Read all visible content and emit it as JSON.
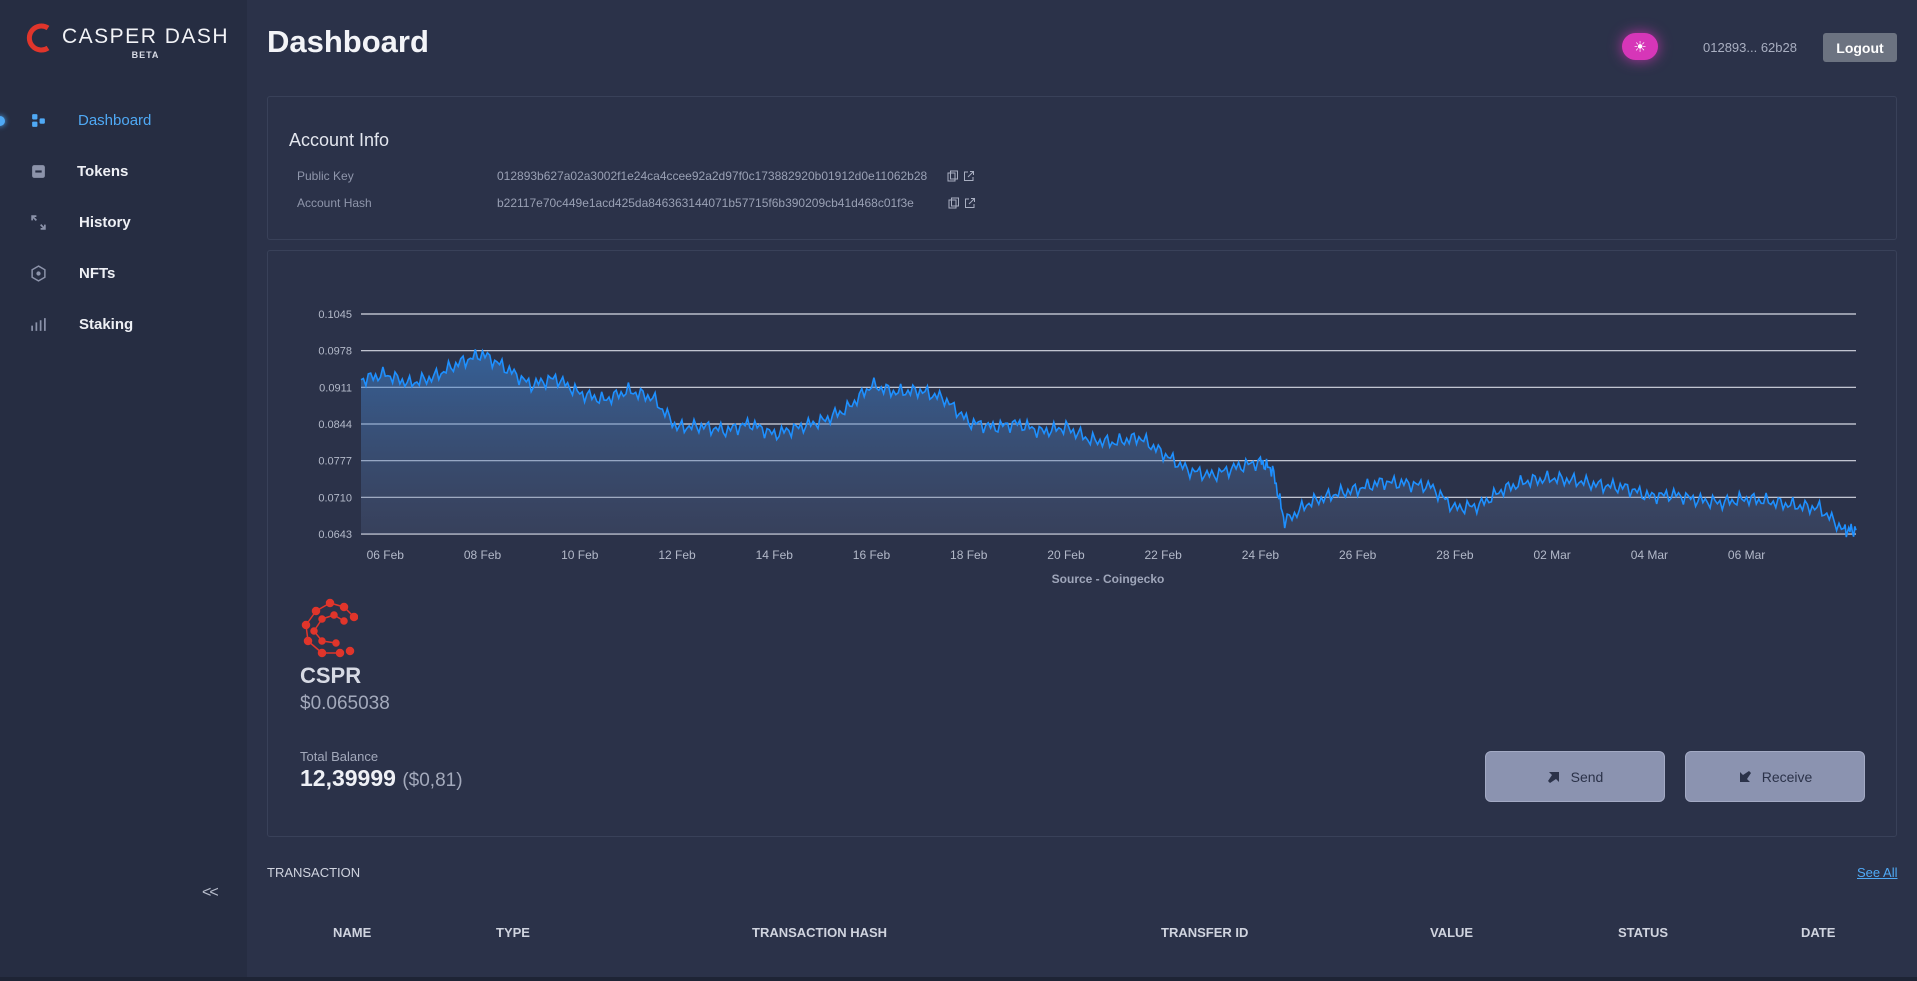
{
  "app": {
    "title": "CASPER DASH",
    "badge": "BETA",
    "accent_color": "#4fa9f5",
    "brand_color": "#e0352b"
  },
  "sidebar": {
    "items": [
      {
        "label": "Dashboard",
        "icon": "dashboard-icon",
        "active": true
      },
      {
        "label": "Tokens",
        "icon": "tokens-icon",
        "active": false
      },
      {
        "label": "History",
        "icon": "history-icon",
        "active": false
      },
      {
        "label": "NFTs",
        "icon": "nfts-icon",
        "active": false
      },
      {
        "label": "Staking",
        "icon": "staking-icon",
        "active": false
      }
    ],
    "collapse_label": "<<"
  },
  "header": {
    "title": "Dashboard",
    "theme_toggle_icon": "sun-icon",
    "account_short": "012893... 62b28",
    "logout_label": "Logout"
  },
  "account_info": {
    "title": "Account Info",
    "public_key_label": "Public Key",
    "public_key": "012893b627a02a3002f1e24ca4ccee92a2d97f0c173882920b01912d0e11062b28",
    "account_hash_label": "Account Hash",
    "account_hash": "b22117e70c449e1acd425da846363144071b57715f6b390209cb41d468c01f3e"
  },
  "chart_data": {
    "type": "area",
    "title": "",
    "xlabel": "Source - Coingecko",
    "ylabel": "",
    "ylim": [
      0.0643,
      0.1045
    ],
    "yticks": [
      "0.1045",
      "0.0978",
      "0.0911",
      "0.0844",
      "0.0777",
      "0.0710",
      "0.0643"
    ],
    "xticks": [
      "06 Feb",
      "08 Feb",
      "10 Feb",
      "12 Feb",
      "14 Feb",
      "16 Feb",
      "18 Feb",
      "20 Feb",
      "22 Feb",
      "24 Feb",
      "26 Feb",
      "28 Feb",
      "02 Mar",
      "04 Mar",
      "06 Mar"
    ],
    "grid": true,
    "line_color": "#1e90ff",
    "series": [
      {
        "x": [
          "2022-02-05 12:00",
          "2022-02-06",
          "2022-02-06 12:00",
          "2022-02-07",
          "2022-02-07 12:00",
          "2022-02-08",
          "2022-02-08 12:00",
          "2022-02-09",
          "2022-02-09 12:00",
          "2022-02-10",
          "2022-02-10 12:00",
          "2022-02-11",
          "2022-02-11 12:00",
          "2022-02-12",
          "2022-02-12 12:00",
          "2022-02-13",
          "2022-02-13 12:00",
          "2022-02-14",
          "2022-02-14 12:00",
          "2022-02-15",
          "2022-02-15 12:00",
          "2022-02-16",
          "2022-02-16 12:00",
          "2022-02-17",
          "2022-02-17 12:00",
          "2022-02-18",
          "2022-02-18 12:00",
          "2022-02-19",
          "2022-02-19 12:00",
          "2022-02-20",
          "2022-02-20 12:00",
          "2022-02-21",
          "2022-02-21 12:00",
          "2022-02-22",
          "2022-02-22 12:00",
          "2022-02-23",
          "2022-02-23 12:00",
          "2022-02-24",
          "2022-02-24 06:00",
          "2022-02-24 12:00",
          "2022-02-25",
          "2022-02-25 12:00",
          "2022-02-26",
          "2022-02-26 12:00",
          "2022-02-27",
          "2022-02-27 12:00",
          "2022-02-28",
          "2022-02-28 12:00",
          "2022-03-01",
          "2022-03-01 12:00",
          "2022-03-02",
          "2022-03-02 12:00",
          "2022-03-03",
          "2022-03-03 12:00",
          "2022-03-04",
          "2022-03-04 12:00",
          "2022-03-05",
          "2022-03-05 12:00",
          "2022-03-06",
          "2022-03-06 12:00",
          "2022-03-07",
          "2022-03-07 12:00",
          "2022-03-08",
          "2022-03-08 06:00"
        ],
        "y": [
          0.0925,
          0.0935,
          0.0918,
          0.093,
          0.0955,
          0.0972,
          0.0945,
          0.0915,
          0.0928,
          0.09,
          0.0888,
          0.0905,
          0.0892,
          0.0838,
          0.084,
          0.0832,
          0.0845,
          0.0825,
          0.0838,
          0.085,
          0.0872,
          0.0915,
          0.0902,
          0.0905,
          0.089,
          0.0848,
          0.0838,
          0.0845,
          0.083,
          0.0838,
          0.0815,
          0.081,
          0.082,
          0.079,
          0.076,
          0.075,
          0.0765,
          0.0775,
          0.076,
          0.0665,
          0.07,
          0.0715,
          0.0725,
          0.0738,
          0.0735,
          0.073,
          0.069,
          0.0695,
          0.0725,
          0.074,
          0.0745,
          0.074,
          0.0732,
          0.0728,
          0.0712,
          0.0715,
          0.0705,
          0.07,
          0.0708,
          0.0702,
          0.0695,
          0.069,
          0.065,
          0.065
        ]
      }
    ]
  },
  "coin": {
    "symbol": "CSPR",
    "price": "$0.065038",
    "total_balance_label": "Total Balance",
    "total_balance": "12,39999",
    "total_balance_usd": "($0,81)",
    "send_label": "Send",
    "receive_label": "Receive"
  },
  "transactions": {
    "title": "TRANSACTION",
    "see_all_label": "See All",
    "columns": [
      "NAME",
      "TYPE",
      "TRANSACTION HASH",
      "TRANSFER ID",
      "VALUE",
      "STATUS",
      "DATE"
    ]
  }
}
